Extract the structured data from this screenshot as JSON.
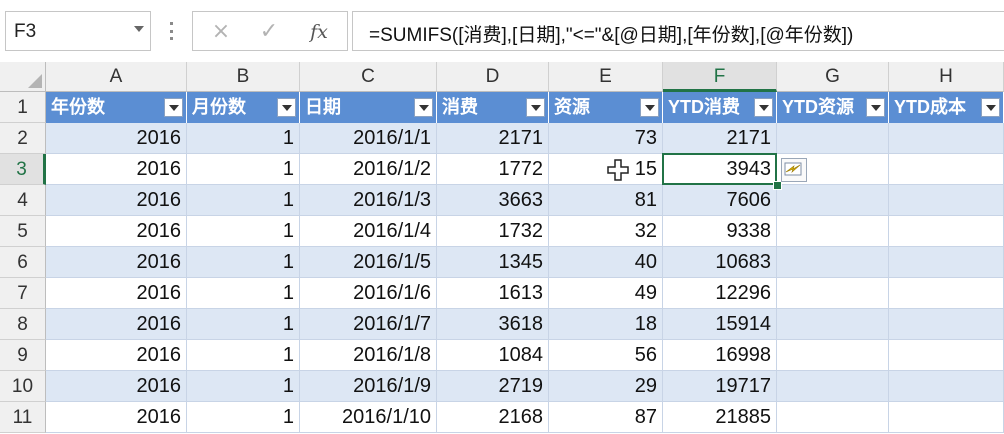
{
  "formula_bar": {
    "name_box": "F3",
    "cancel_glyph": "×",
    "enter_glyph": "✓",
    "fx_glyph": "fx",
    "formula": "=SUMIFS([消费],[日期],\"<=\"&[@日期],[年份数],[@年份数])"
  },
  "columns": [
    "A",
    "B",
    "C",
    "D",
    "E",
    "F",
    "G",
    "H"
  ],
  "selected_column": "F",
  "rows": [
    "1",
    "2",
    "3",
    "4",
    "5",
    "6",
    "7",
    "8",
    "9",
    "10",
    "11"
  ],
  "selected_row": "3",
  "table_headers": [
    "年份数",
    "月份数",
    "日期",
    "消费",
    "资源",
    "YTD消费",
    "YTD资源",
    "YTD成本"
  ],
  "table_rows": [
    [
      "2016",
      "1",
      "2016/1/1",
      "2171",
      "73",
      "2171",
      "",
      ""
    ],
    [
      "2016",
      "1",
      "2016/1/2",
      "1772",
      "15",
      "3943",
      "",
      ""
    ],
    [
      "2016",
      "1",
      "2016/1/3",
      "3663",
      "81",
      "7606",
      "",
      ""
    ],
    [
      "2016",
      "1",
      "2016/1/4",
      "1732",
      "32",
      "9338",
      "",
      ""
    ],
    [
      "2016",
      "1",
      "2016/1/5",
      "1345",
      "40",
      "10683",
      "",
      ""
    ],
    [
      "2016",
      "1",
      "2016/1/6",
      "1613",
      "49",
      "12296",
      "",
      ""
    ],
    [
      "2016",
      "1",
      "2016/1/7",
      "3618",
      "18",
      "15914",
      "",
      ""
    ],
    [
      "2016",
      "1",
      "2016/1/8",
      "1084",
      "56",
      "16998",
      "",
      ""
    ],
    [
      "2016",
      "1",
      "2016/1/9",
      "2719",
      "29",
      "19717",
      "",
      ""
    ],
    [
      "2016",
      "1",
      "2016/1/10",
      "2168",
      "87",
      "21885",
      "",
      ""
    ]
  ],
  "active_cell": "F3",
  "icons": {
    "quick_analysis": "autofill-options-icon",
    "cursor": "cell-select-cursor-icon",
    "filter": "filter-dropdown-icon"
  },
  "colors": {
    "header_fill": "#5b8ed3",
    "band_fill": "#dde7f4",
    "selection": "#217346"
  }
}
